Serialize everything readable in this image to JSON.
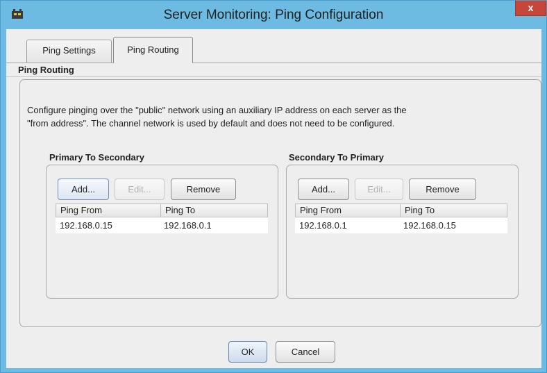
{
  "window": {
    "title": "Server Monitoring: Ping Configuration",
    "close_label": "x",
    "app_icon": "app-icon"
  },
  "tabs": [
    {
      "label": "Ping Settings",
      "selected": false
    },
    {
      "label": "Ping Routing",
      "selected": true
    }
  ],
  "section": {
    "title": "Ping Routing",
    "description_line1": "Configure pinging over the \"public\" network using an auxiliary IP address on each server as the",
    "description_line2": "\"from address\". The channel network is used by default and does not need to be configured."
  },
  "groups": [
    {
      "title": "Primary To Secondary",
      "add_label": "Add...",
      "edit_label": "Edit...",
      "remove_label": "Remove",
      "columns": [
        "Ping From",
        "Ping To"
      ],
      "rows": [
        {
          "from": "192.168.0.15",
          "to": "192.168.0.1"
        }
      ]
    },
    {
      "title": "Secondary To Primary",
      "add_label": "Add...",
      "edit_label": "Edit...",
      "remove_label": "Remove",
      "columns": [
        "Ping From",
        "Ping To"
      ],
      "rows": [
        {
          "from": "192.168.0.1",
          "to": "192.168.0.15"
        }
      ]
    }
  ],
  "footer": {
    "ok_label": "OK",
    "cancel_label": "Cancel"
  },
  "colors": {
    "titlebar": "#6dbbe3",
    "close_button": "#c7463a",
    "dialog_background": "#eeeeee"
  }
}
